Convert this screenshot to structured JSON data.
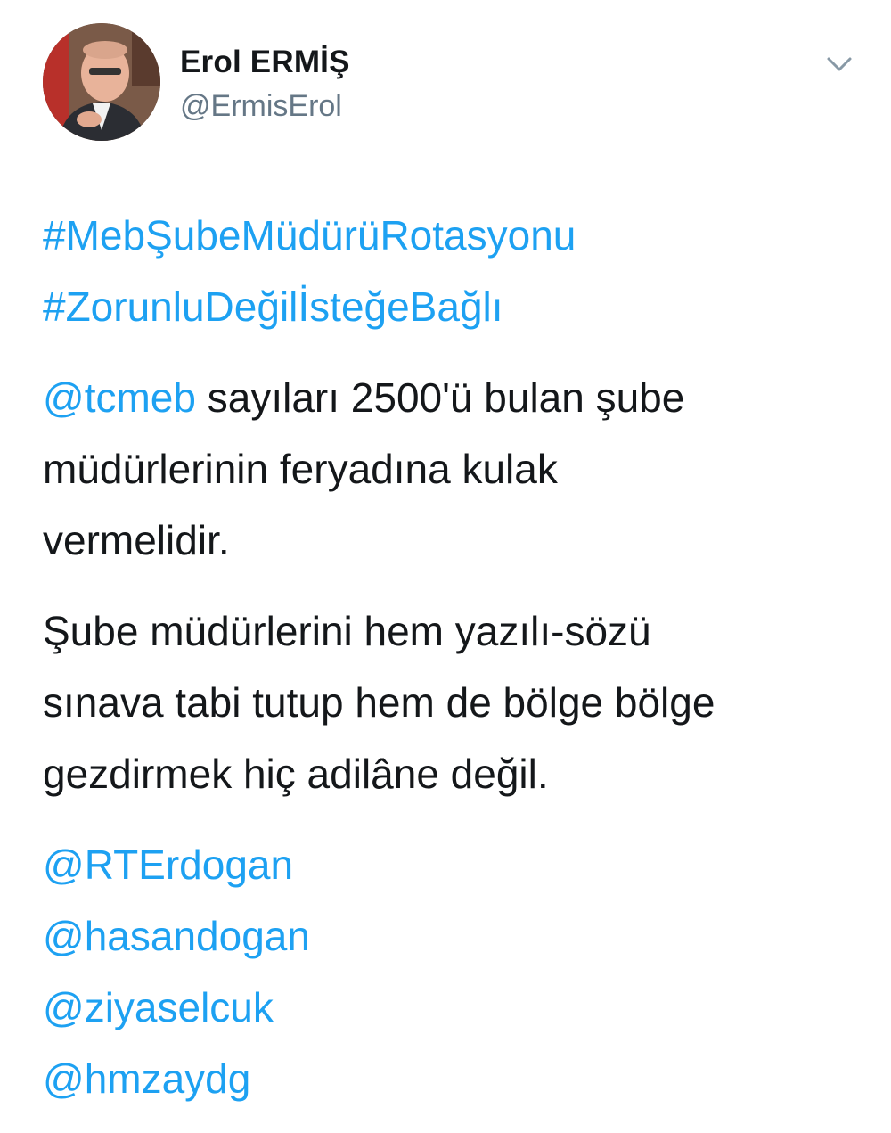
{
  "author": {
    "display_name": "Erol ERMİŞ",
    "handle": "@ErmisErol",
    "avatar_icon": "profile-photo"
  },
  "menu": {
    "icon": "chevron-down-icon"
  },
  "colors": {
    "link": "#1da1f2",
    "text": "#14171a",
    "secondary": "#657786"
  },
  "tweet": {
    "hashtags": [
      "#MebŞubeMüdürüRotasyonu",
      "#ZorunluDeğilİsteğeBağlı"
    ],
    "mention_tcmeb": "@tcmeb",
    "para1_line1": " sayıları 2500'ü bulan şube",
    "para1_line2": "müdürlerinin feryadına kulak",
    "para1_line3": "vermelidir.",
    "para2_line1": "Şube müdürlerini hem yazılı-sözü",
    "para2_line2": "sınava tabi tutup hem de bölge bölge",
    "para2_line3": "gezdirmek hiç adilâne değil.",
    "mentions": [
      "@RTErdogan",
      "@hasandogan",
      "@ziyaselcuk",
      "@hmzaydg"
    ]
  }
}
